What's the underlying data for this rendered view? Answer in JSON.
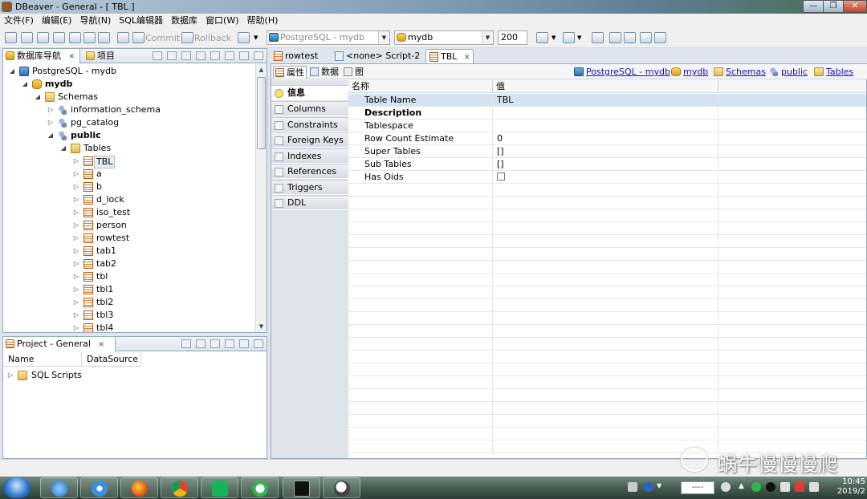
{
  "window": {
    "title": "DBeaver - General - [ TBL ]",
    "minimize": "—",
    "maximize": "❐",
    "close": "✕"
  },
  "menu": [
    "文件(F)",
    "编辑(E)",
    "导航(N)",
    "SQL编辑器",
    "数据库",
    "窗口(W)",
    "帮助(H)"
  ],
  "toolbar": {
    "commit_label": "Commit",
    "rollback_label": "Rollback",
    "connection_combo": "PostgreSQL - mydb",
    "database_combo": "mydb",
    "result_limit": "200"
  },
  "navigator": {
    "tab_label": "数据库导航",
    "projects_tab_label": "项目",
    "tree": {
      "connection": "PostgreSQL - mydb",
      "database": "mydb",
      "schemas_folder": "Schemas",
      "schema_info": "information_schema",
      "schema_pg": "pg_catalog",
      "schema_public": "public",
      "tables_folder": "Tables",
      "tables": [
        "TBL",
        "a",
        "b",
        "d_lock",
        "iso_test",
        "person",
        "rowtest",
        "tab1",
        "tab2",
        "tbl",
        "tbl1",
        "tbl2",
        "tbl3",
        "tbl4"
      ]
    }
  },
  "project": {
    "tab_label": "Project - General",
    "col_name": "Name",
    "col_datasource": "DataSource",
    "item": "SQL Scripts"
  },
  "editor_tabs": [
    {
      "label": "rowtest"
    },
    {
      "label": "<none> Script-2"
    },
    {
      "label": "TBL"
    }
  ],
  "subtabs": [
    "属性",
    "数据",
    "图"
  ],
  "breadcrumbs": [
    "PostgreSQL - mydb",
    "mydb",
    "Schemas",
    "public",
    "Tables"
  ],
  "sidetabs": [
    "信息",
    "Columns",
    "Constraints",
    "Foreign Keys",
    "Indexes",
    "References",
    "Triggers",
    "DDL"
  ],
  "grid": {
    "header_name": "名称",
    "header_value": "值",
    "rows": [
      {
        "name": "Table Name",
        "value": "TBL"
      },
      {
        "name": "Description",
        "value": ""
      },
      {
        "name": "Tablespace",
        "value": ""
      },
      {
        "name": "Row Count Estimate",
        "value": "0"
      },
      {
        "name": "Super Tables",
        "value": "[]"
      },
      {
        "name": "Sub Tables",
        "value": "[]"
      },
      {
        "name": "Has Oids",
        "value": ""
      }
    ]
  },
  "watermark": "蜗牛慢慢慢爬",
  "taskbar": {
    "ime": "----",
    "time": "10:45",
    "date": "2019/2"
  },
  "colors": {
    "accent": "#99a8bb",
    "selection": "#d4e2f3",
    "link": "#1a0dab"
  },
  "icons": [
    "search-icon",
    "table-icon",
    "database-icon",
    "folder-icon",
    "schema-icon",
    "connection-icon"
  ]
}
